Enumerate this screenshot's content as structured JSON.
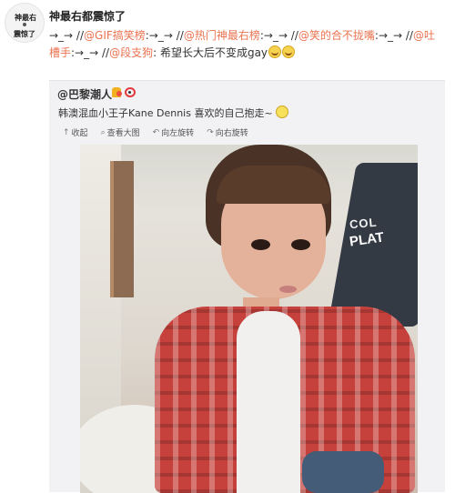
{
  "post": {
    "avatar_text_1": "神最右",
    "avatar_text_2": "震惊了",
    "author": "神最右都震惊了",
    "text": {
      "line1_prefix": "→_→ //",
      "mention1": "@GIF搞笑榜",
      "seg1": ":→_→ //",
      "mention2": "@热门神最右榜",
      "seg2": ":→_→ //",
      "mention3": "@笑的合不拢嘴",
      "seg3": ":→_→ //",
      "mention4a": "@吐",
      "mention4b": "槽手",
      "seg4": ":→_→ //",
      "mention5": "@段支狗",
      "seg5": ": 希望长大后不变成gay"
    }
  },
  "repost": {
    "author": "@巴黎潮人",
    "text": "韩澳混血小王子Kane Dennis 喜欢的自己抱走~",
    "actions": [
      {
        "icon": "↑",
        "label": "收起"
      },
      {
        "icon": "⌕",
        "label": "查看大图"
      },
      {
        "icon": "↶",
        "label": "向左旋转"
      },
      {
        "icon": "↷",
        "label": "向右旋转"
      }
    ],
    "photo_sign_1": "COL",
    "photo_sign_2": "PLAT"
  },
  "colors": {
    "mention": "#eb7350",
    "repost_bg": "#f2f2f5"
  }
}
